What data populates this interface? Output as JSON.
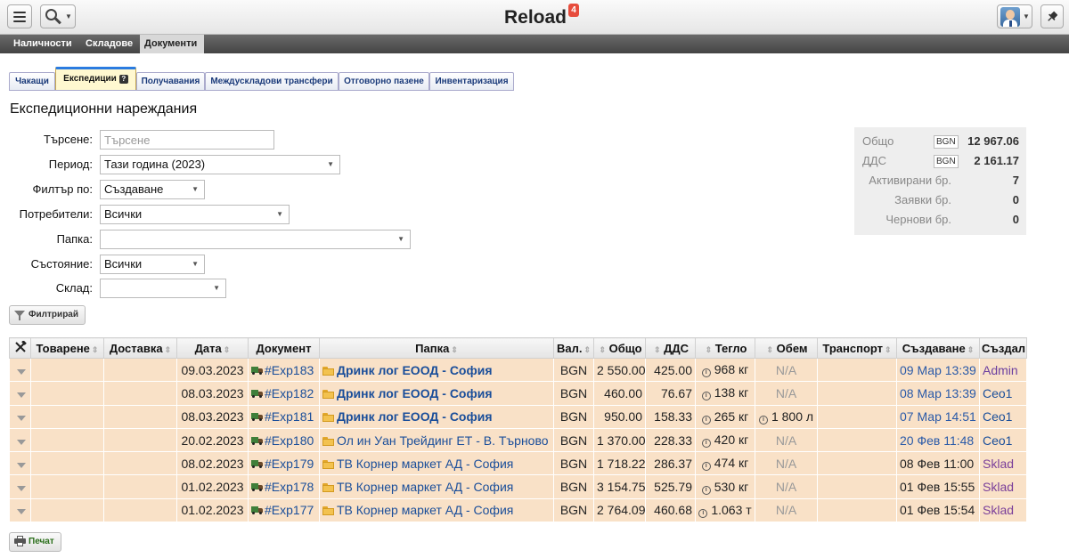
{
  "topbar": {
    "title": "Reload",
    "notification_count": "4"
  },
  "modules": [
    "Наличности",
    "Складове",
    "Документи"
  ],
  "tabs": [
    {
      "label": "Чакащи"
    },
    {
      "label": "Експедиции"
    },
    {
      "label": "Получавания"
    },
    {
      "label": "Междускладови трансфери"
    },
    {
      "label": "Отговорно пазене"
    },
    {
      "label": "Инвентаризация"
    }
  ],
  "page": {
    "title": "Експедиционни нареждания"
  },
  "filters": {
    "search_label": "Търсене:",
    "search_placeholder": "Търсене",
    "period_label": "Период:",
    "period_value": "Тази година (2023)",
    "filter_by_label": "Филтър по:",
    "filter_by_value": "Създаване",
    "users_label": "Потребители:",
    "users_value": "Всички",
    "folder_label": "Папка:",
    "folder_value": "",
    "state_label": "Състояние:",
    "state_value": "Всички",
    "store_label": "Склад:",
    "store_value": "",
    "filter_button": "Филтрирай"
  },
  "summary": {
    "total_label": "Общо",
    "total_currency": "BGN",
    "total_value": "12 967.06",
    "vat_label": "ДДС",
    "vat_currency": "BGN",
    "vat_value": "2 161.17",
    "active_label": "Активирани бр.",
    "active_value": "7",
    "requests_label": "Заявки бр.",
    "requests_value": "0",
    "drafts_label": "Чернови бр.",
    "drafts_value": "0"
  },
  "table": {
    "columns": [
      "Товарене",
      "Доставка",
      "Дата",
      "Документ",
      "Папка",
      "Вал.",
      "Общо",
      "ДДС",
      "Тегло",
      "Обем",
      "Транспорт",
      "Създаване",
      "Създал"
    ],
    "rows": [
      {
        "date": "09.03.2023",
        "doc": "#Exp183",
        "folder": "Дринк лог ЕООД - София",
        "bold": true,
        "cur": "BGN",
        "total": "2 550.00",
        "vat": "425.00",
        "weight": "968 кг",
        "volume": "N/A",
        "created": "09 Мар 13:39",
        "created_style": "ts",
        "by": "Admin",
        "by_style": "user-admin"
      },
      {
        "date": "08.03.2023",
        "doc": "#Exp182",
        "folder": "Дринк лог ЕООД - София",
        "bold": true,
        "cur": "BGN",
        "total": "460.00",
        "vat": "76.67",
        "weight": "138 кг",
        "volume": "N/A",
        "created": "08 Мар 13:39",
        "created_style": "ts",
        "by": "Ceo1",
        "by_style": "user-ceo"
      },
      {
        "date": "08.03.2023",
        "doc": "#Exp181",
        "folder": "Дринк лог ЕООД - София",
        "bold": true,
        "cur": "BGN",
        "total": "950.00",
        "vat": "158.33",
        "weight": "265 кг",
        "volume": "1 800 л",
        "created": "07 Мар 14:51",
        "created_style": "ts",
        "by": "Ceo1",
        "by_style": "user-ceo"
      },
      {
        "date": "20.02.2023",
        "doc": "#Exp180",
        "folder": "Ол ин Уан Трейдинг ЕТ - В. Търново",
        "bold": false,
        "cur": "BGN",
        "total": "1 370.00",
        "vat": "228.33",
        "weight": "420 кг",
        "volume": "N/A",
        "created": "20 Фев 11:48",
        "created_style": "ts",
        "by": "Ceo1",
        "by_style": "user-ceo"
      },
      {
        "date": "08.02.2023",
        "doc": "#Exp179",
        "folder": "ТВ Корнер маркет АД - София",
        "bold": false,
        "cur": "BGN",
        "total": "1 718.22",
        "vat": "286.37",
        "weight": "474 кг",
        "volume": "N/A",
        "created": "08 Фев 11:00",
        "created_style": "ts-dark",
        "by": "Sklad",
        "by_style": "user-sklad"
      },
      {
        "date": "01.02.2023",
        "doc": "#Exp178",
        "folder": "ТВ Корнер маркет АД - София",
        "bold": false,
        "cur": "BGN",
        "total": "3 154.75",
        "vat": "525.79",
        "weight": "530 кг",
        "volume": "N/A",
        "created": "01 Фев 15:55",
        "created_style": "ts-dark",
        "by": "Sklad",
        "by_style": "user-sklad"
      },
      {
        "date": "01.02.2023",
        "doc": "#Exp177",
        "folder": "ТВ Корнер маркет АД - София",
        "bold": false,
        "cur": "BGN",
        "total": "2 764.09",
        "vat": "460.68",
        "weight": "1.063 т",
        "volume": "N/A",
        "created": "01 Фев 15:54",
        "created_style": "ts-dark",
        "by": "Sklad",
        "by_style": "user-sklad"
      }
    ]
  },
  "print_button": "Печат",
  "colors": {
    "row_bg": "#f9e1c7",
    "link": "#1a4e9a",
    "active_tab_bg": "#fff8d0"
  }
}
